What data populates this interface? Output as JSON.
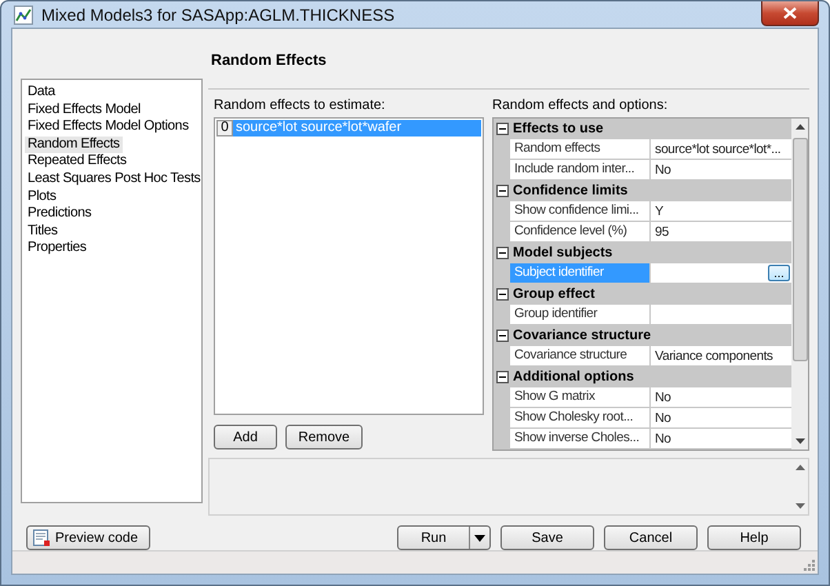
{
  "window": {
    "title": "Mixed Models3 for SASApp:AGLM.THICKNESS"
  },
  "nav": {
    "items": [
      {
        "label": "Data",
        "selected": false
      },
      {
        "label": "Fixed Effects Model",
        "selected": false
      },
      {
        "label": "Fixed Effects Model Options",
        "selected": false
      },
      {
        "label": "Random Effects",
        "selected": true
      },
      {
        "label": "Repeated Effects",
        "selected": false
      },
      {
        "label": "Least Squares Post Hoc Tests",
        "selected": false
      },
      {
        "label": "Plots",
        "selected": false
      },
      {
        "label": "Predictions",
        "selected": false
      },
      {
        "label": "Titles",
        "selected": false
      },
      {
        "label": "Properties",
        "selected": false
      }
    ]
  },
  "page_title": "Random Effects",
  "effects_list": {
    "label": "Random effects to estimate:",
    "rows": [
      {
        "index": "0",
        "text": "source*lot source*lot*wafer",
        "selected": true
      }
    ]
  },
  "list_buttons": [
    "Add",
    "Remove"
  ],
  "properties": {
    "label": "Random effects and options:",
    "categories": [
      {
        "title": "Effects to use",
        "expanded": true,
        "rows": [
          {
            "name": "Random effects",
            "value": "source*lot source*lot*...",
            "selected": false
          },
          {
            "name": "Include random inter...",
            "value": "No",
            "selected": false
          }
        ]
      },
      {
        "title": "Confidence limits",
        "expanded": true,
        "rows": [
          {
            "name": "Show confidence limi...",
            "value": "Y",
            "selected": false
          },
          {
            "name": "Confidence level (%)",
            "value": "95",
            "selected": false
          }
        ]
      },
      {
        "title": "Model subjects",
        "expanded": true,
        "rows": [
          {
            "name": "Subject identifier",
            "value": "",
            "selected": true,
            "button": "..."
          }
        ]
      },
      {
        "title": "Group effect",
        "expanded": true,
        "rows": [
          {
            "name": "Group identifier",
            "value": "",
            "selected": false
          }
        ]
      },
      {
        "title": "Covariance structure",
        "expanded": true,
        "rows": [
          {
            "name": "Covariance structure",
            "value": "Variance components",
            "selected": false
          }
        ]
      },
      {
        "title": "Additional options",
        "expanded": true,
        "rows": [
          {
            "name": "Show G matrix",
            "value": "No",
            "selected": false
          },
          {
            "name": "Show Cholesky root...",
            "value": "No",
            "selected": false
          },
          {
            "name": "Show inverse Choles...",
            "value": "No",
            "selected": false
          }
        ]
      }
    ]
  },
  "preview_button": "Preview code",
  "actions": [
    {
      "label": "Run",
      "kind": "split"
    },
    {
      "label": "Save",
      "kind": "plain"
    },
    {
      "label": "Cancel",
      "kind": "plain"
    },
    {
      "label": "Help",
      "kind": "plain"
    }
  ]
}
